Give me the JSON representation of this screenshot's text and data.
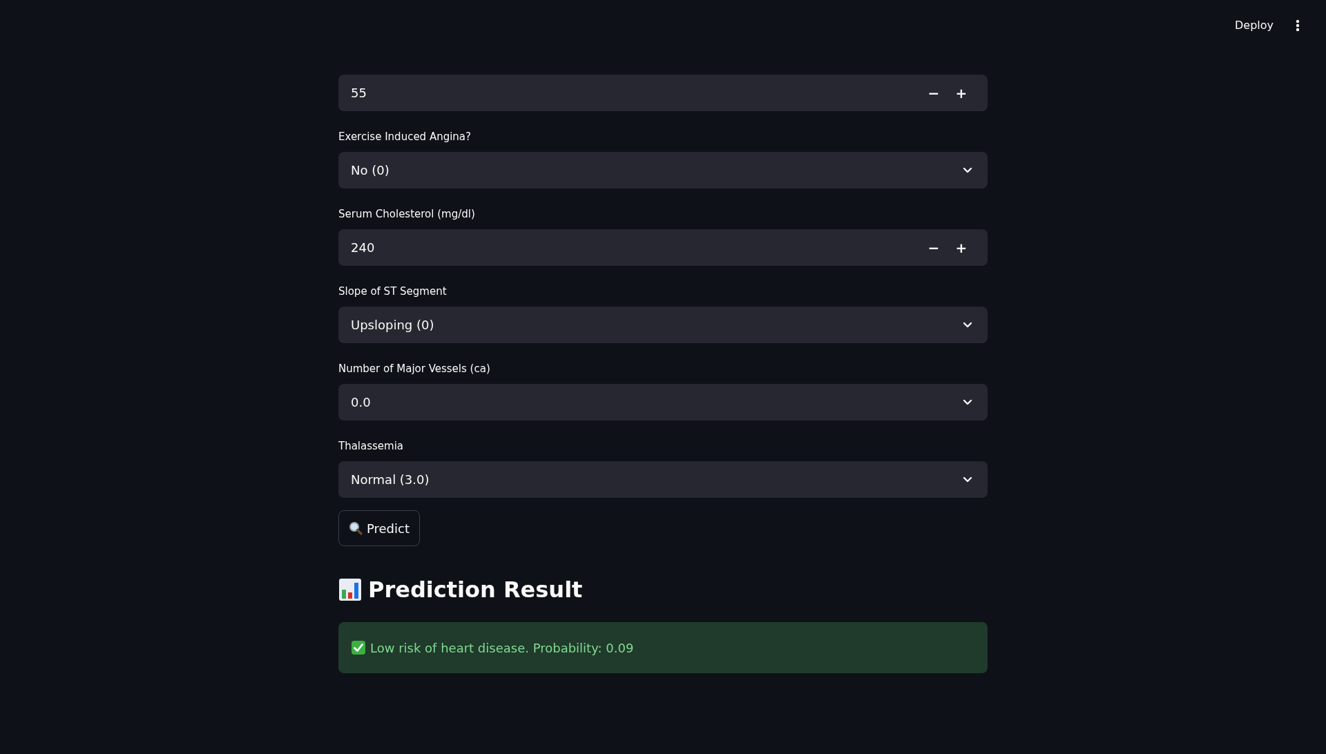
{
  "header": {
    "deploy": "Deploy"
  },
  "fields": [
    {
      "kind": "number",
      "value": "55",
      "minus": "−",
      "plus": "+"
    },
    {
      "kind": "select",
      "label": "Exercise Induced Angina?",
      "value": "No (0)"
    },
    {
      "kind": "number",
      "label": "Serum Cholesterol (mg/dl)",
      "value": "240",
      "minus": "−",
      "plus": "+"
    },
    {
      "kind": "select",
      "label": "Slope of ST Segment",
      "value": "Upsloping (0)"
    },
    {
      "kind": "select",
      "label": "Number of Major Vessels (ca)",
      "value": "0.0"
    },
    {
      "kind": "select",
      "label": "Thalassemia",
      "value": "Normal (3.0)"
    }
  ],
  "predict_button": "Predict",
  "result": {
    "heading": "Prediction Result",
    "message": "Low risk of heart disease. Probability: 0.09"
  }
}
